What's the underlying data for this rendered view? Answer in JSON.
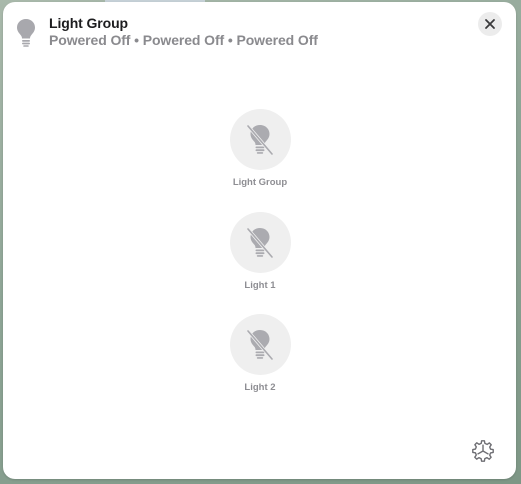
{
  "header": {
    "icon": "lightbulb-icon",
    "title": "Light Group",
    "status": "Powered Off • Powered Off • Powered Off"
  },
  "close_icon": "close-icon",
  "accessories": [
    {
      "label": "Light Group",
      "state": "off",
      "icon": "lightbulb-off-icon"
    },
    {
      "label": "Light 1",
      "state": "off",
      "icon": "lightbulb-off-icon"
    },
    {
      "label": "Light 2",
      "state": "off",
      "icon": "lightbulb-off-icon"
    }
  ],
  "settings_icon": "gear-icon",
  "colors": {
    "panel": "#ffffff",
    "title": "#1d1d1f",
    "subtitle": "#8a8a8e",
    "tile": "#efefef",
    "icon": "#a8a8ad"
  }
}
